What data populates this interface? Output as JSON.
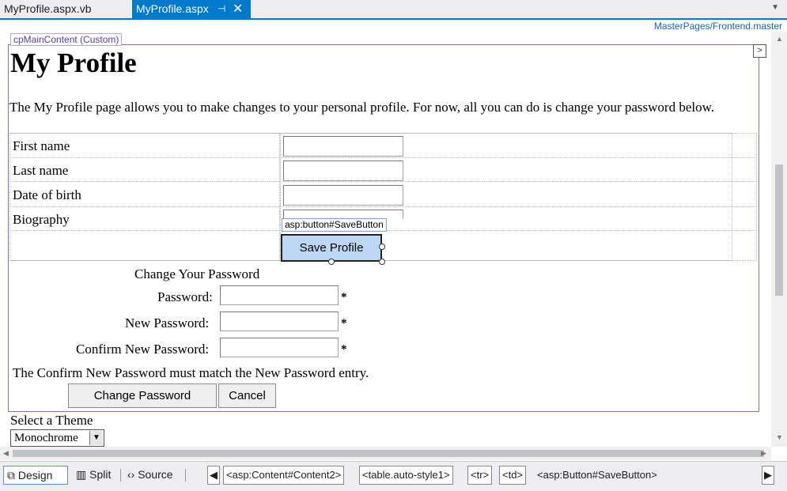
{
  "tabs": {
    "inactive_label": "MyProfile.aspx.vb",
    "active_label": "MyProfile.aspx",
    "pin_glyph": "⊣",
    "close_glyph": "✕"
  },
  "master_path": "MasterPages/Frontend.master",
  "content_region": {
    "label": "cpMainContent (Custom)",
    "smart_tag_glyph": ">"
  },
  "page": {
    "heading": "My Profile",
    "intro": "The My Profile page allows you to make changes to your personal profile. For now, all you can do is change your password below."
  },
  "profile_form": {
    "first_name_label": "First name",
    "last_name_label": "Last name",
    "dob_label": "Date of birth",
    "bio_label": "Biography",
    "selected_tag": "asp:button#SaveButton",
    "save_button_label": "Save Profile"
  },
  "password_form": {
    "title": "Change Your Password",
    "password_label": "Password:",
    "new_password_label": "New Password:",
    "confirm_label": "Confirm New Password:",
    "required_mark": "*",
    "validation_message": "The Confirm New Password must match the New Password entry.",
    "change_button_label": "Change Password",
    "cancel_button_label": "Cancel"
  },
  "theme": {
    "label": "Select a Theme",
    "selected": "Monochrome",
    "arrow": "▼"
  },
  "bottom_bar": {
    "views": [
      "Design",
      "Split",
      "Source"
    ],
    "breadcrumbs": [
      "<asp:Content#Content2>",
      "<table.auto-style1>",
      "<tr>",
      "<td>",
      "<asp:Button#SaveButton>"
    ]
  },
  "colors": {
    "accent": "#007acc",
    "content_border": "#8a6fb8",
    "selected_button": "#bcd8f5"
  }
}
